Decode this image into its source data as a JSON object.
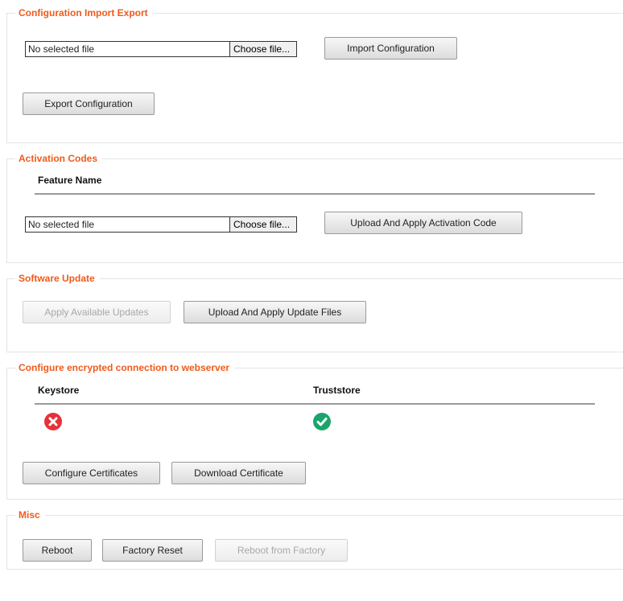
{
  "import_export": {
    "title": "Configuration Import Export",
    "file_name": "No selected file",
    "choose_label": "Choose file...",
    "import_label": "Import Configuration",
    "export_label": "Export Configuration"
  },
  "activation": {
    "title": "Activation Codes",
    "column_header": "Feature Name",
    "file_name": "No selected file",
    "choose_label": "Choose file...",
    "upload_label": "Upload And Apply Activation Code"
  },
  "software_update": {
    "title": "Software Update",
    "apply_label": "Apply Available Updates",
    "apply_enabled": false,
    "upload_label": "Upload And Apply Update Files"
  },
  "encryption": {
    "title": "Configure encrypted connection to webserver",
    "keystore_header": "Keystore",
    "truststore_header": "Truststore",
    "keystore_status": "error",
    "truststore_status": "ok",
    "status_colors": {
      "error": "#e8303a",
      "ok": "#1aa56b"
    },
    "keystore_icon": "x-circle-icon",
    "truststore_icon": "check-circle-icon",
    "configure_label": "Configure Certificates",
    "download_label": "Download Certificate"
  },
  "misc": {
    "title": "Misc",
    "reboot_label": "Reboot",
    "factory_reset_label": "Factory Reset",
    "reboot_factory_label": "Reboot from Factory",
    "reboot_factory_enabled": false
  },
  "theme": {
    "accent": "#f05a1a"
  }
}
